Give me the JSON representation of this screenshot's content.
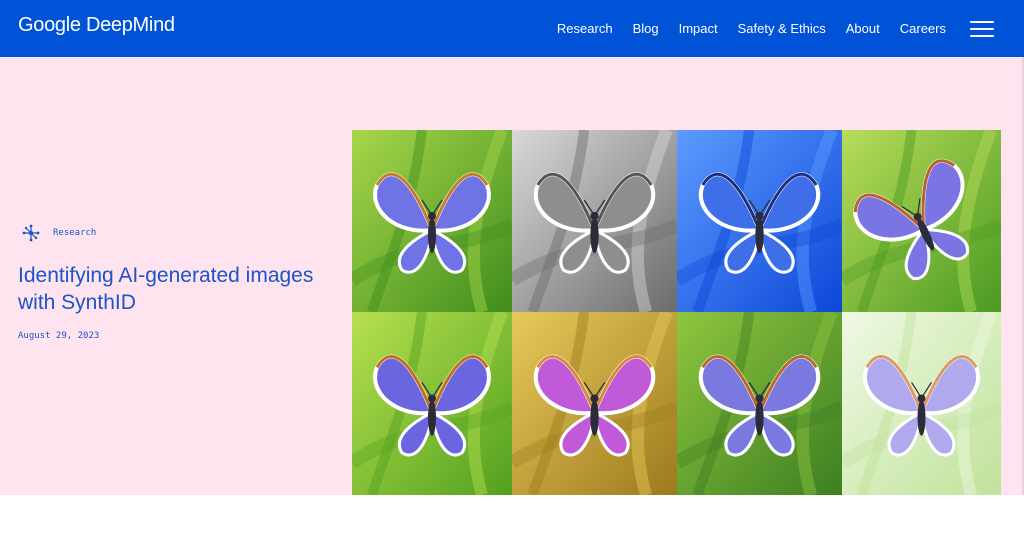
{
  "header": {
    "logo": "Google DeepMind",
    "nav": [
      "Research",
      "Blog",
      "Impact",
      "Safety & Ethics",
      "About",
      "Careers"
    ],
    "menu_icon": "hamburger-menu-icon",
    "bg_color": "#0053d6"
  },
  "hero": {
    "category_icon": "network-nodes-icon",
    "category": "Research",
    "title": "Identifying AI-generated images with SynthID",
    "date": "August 29, 2023",
    "bg_color": "#ffe3ef",
    "accent_color": "#1a55c9"
  },
  "image_grid": {
    "tiles": [
      {
        "name": "butterfly-original",
        "bg1": "#a7d64a",
        "bg2": "#3f8d1d",
        "wing": "#6e74e6",
        "rim": "#c77a2a"
      },
      {
        "name": "butterfly-grayscale",
        "bg1": "#d9d9d9",
        "bg2": "#6b6b6b",
        "wing": "#8e8e8e",
        "rim": "#555555"
      },
      {
        "name": "butterfly-blue-tint",
        "bg1": "#5d9bff",
        "bg2": "#0c46d8",
        "wing": "#3f6fe8",
        "rim": "#1a2f80"
      },
      {
        "name": "butterfly-rotated",
        "bg1": "#b8dc5a",
        "bg2": "#4a9a22",
        "wing": "#7b74e3",
        "rim": "#b8632a"
      },
      {
        "name": "butterfly-saturated",
        "bg1": "#b7e04f",
        "bg2": "#52a01f",
        "wing": "#6a66e0",
        "rim": "#c46c20"
      },
      {
        "name": "butterfly-yellow-tint",
        "bg1": "#e8c95a",
        "bg2": "#9c7a1e",
        "wing": "#c05ad8",
        "rim": "#d68a3c"
      },
      {
        "name": "butterfly-noise",
        "bg1": "#8fc63e",
        "bg2": "#3d7f22",
        "wing": "#7a79e0",
        "rim": "#b76a2c"
      },
      {
        "name": "butterfly-faded",
        "bg1": "#f0f8e4",
        "bg2": "#bfe39a",
        "wing": "#b0a9ee",
        "rim": "#d99a66"
      }
    ]
  }
}
